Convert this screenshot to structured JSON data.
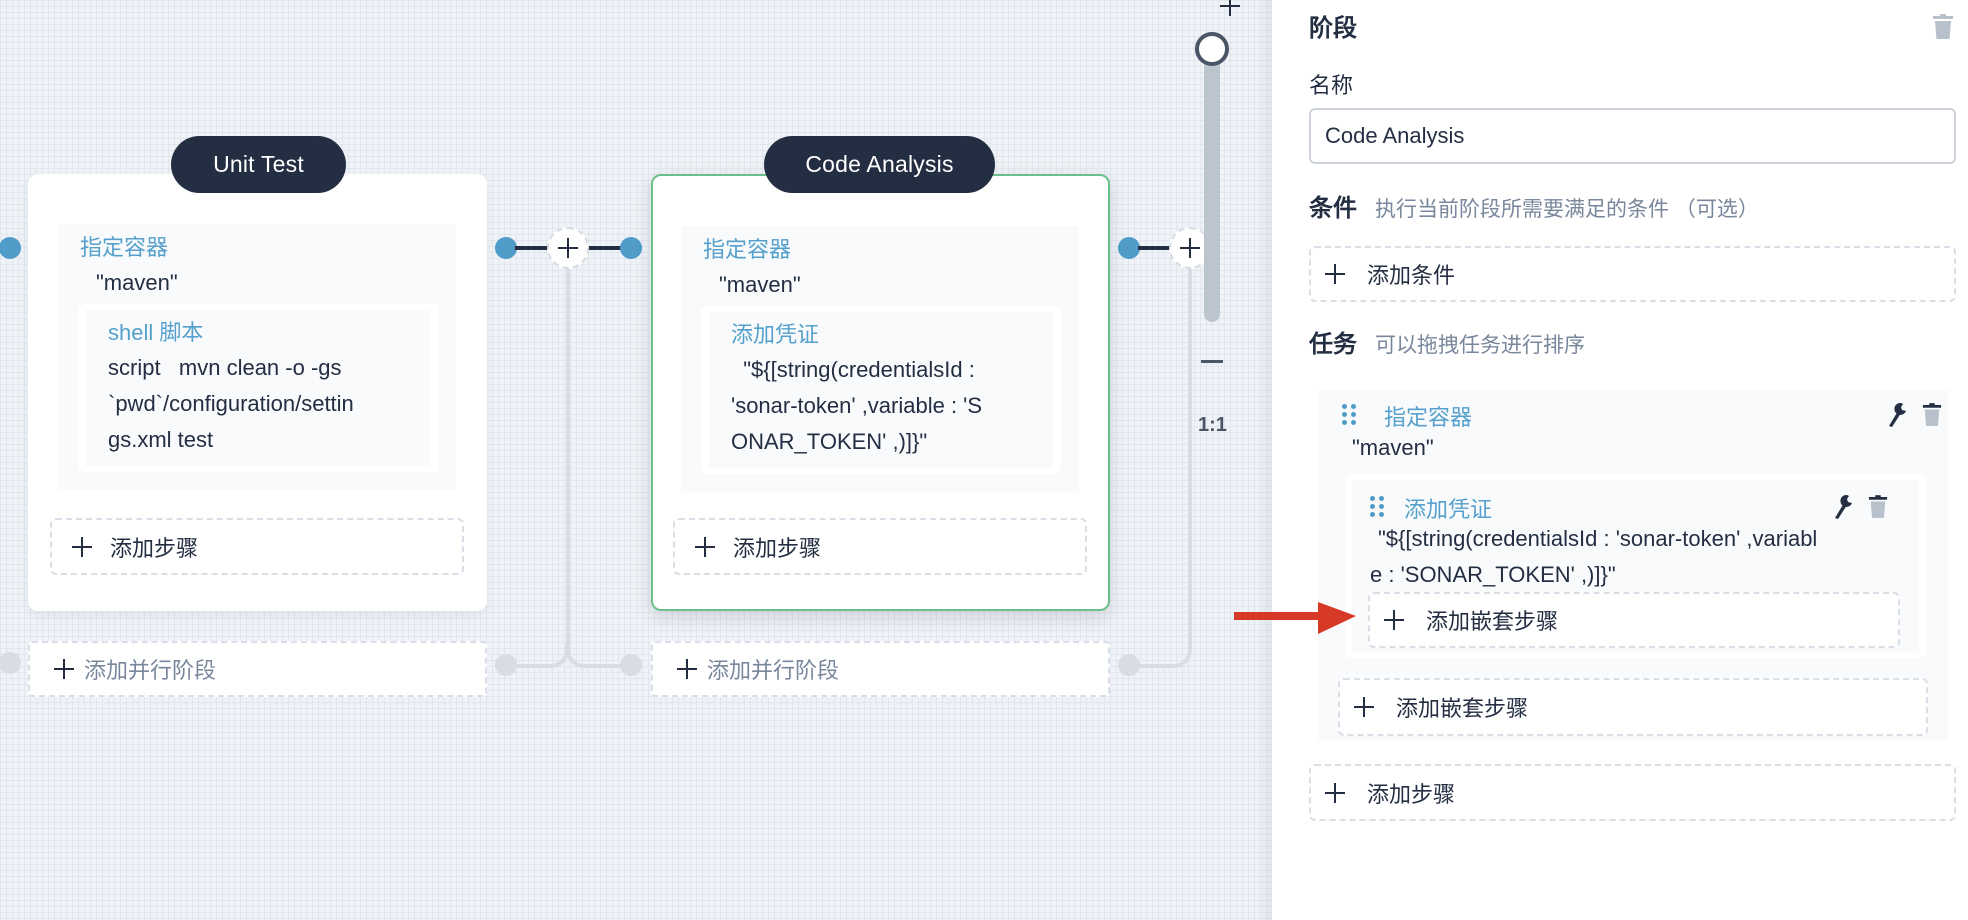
{
  "canvas": {
    "stages": [
      {
        "name": "Unit Test",
        "selected": false,
        "task": {
          "title": "指定容器",
          "value": "\"maven\"",
          "subtask": {
            "title": "shell 脚本",
            "lines": [
              "script   mvn clean -o -gs",
              "`pwd`/configuration/settin",
              "gs.xml test"
            ]
          }
        },
        "add_step_label": "添加步骤",
        "add_parallel_label": "添加并行阶段"
      },
      {
        "name": "Code Analysis",
        "selected": true,
        "task": {
          "title": "指定容器",
          "value": "\"maven\"",
          "subtask": {
            "title": "添加凭证",
            "lines": [
              "  \"${[string(credentialsId :",
              "'sonar-token' ,variable : 'S",
              "ONAR_TOKEN' ,)]}\""
            ]
          }
        },
        "add_step_label": "添加步骤",
        "add_parallel_label": "添加并行阶段"
      }
    ],
    "zoom": {
      "plus_icon": "plus-icon",
      "minus_icon": "minus-icon",
      "ratio_label": "1:1",
      "level": 1.0
    }
  },
  "panel": {
    "title": "阶段",
    "name_label": "名称",
    "name_value": "Code Analysis",
    "conditions": {
      "label": "条件",
      "hint": "执行当前阶段所需要满足的条件 （可选）",
      "add_label": "添加条件"
    },
    "tasks": {
      "label": "任务",
      "hint": "可以拖拽任务进行排序",
      "items": [
        {
          "title": "指定容器",
          "value": "\"maven\"",
          "nested": {
            "title": "添加凭证",
            "lines": [
              "\"${[string(credentialsId : 'sonar-token' ,variabl",
              "e : 'SONAR_TOKEN' ,)]}\""
            ],
            "add_nested_label": "添加嵌套步骤"
          },
          "add_nested_label": "添加嵌套步骤"
        }
      ],
      "add_step_label": "添加步骤"
    }
  },
  "annotation": {
    "arrow_color": "#d63a26",
    "points_to": "添加嵌套步骤"
  },
  "colors": {
    "accent_blue": "#55a0cc",
    "node_blue": "#4f9cc9",
    "dark": "#242e42",
    "selected_border": "#6dbf8a"
  }
}
